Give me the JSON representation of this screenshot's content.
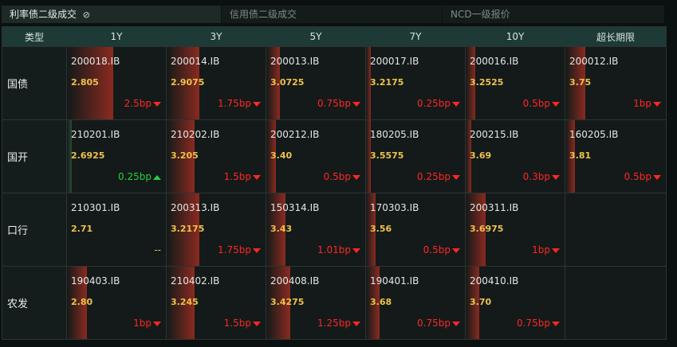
{
  "tabs": [
    {
      "label": "利率债二级成交",
      "active": true
    },
    {
      "label": "信用债二级成交",
      "active": false
    },
    {
      "label": "NCD一级报价",
      "active": false
    }
  ],
  "columns": [
    "类型",
    "1Y",
    "3Y",
    "5Y",
    "7Y",
    "10Y",
    "超长期限"
  ],
  "rows": [
    {
      "label": "国债",
      "cells": [
        {
          "code": "200018.IB",
          "yield": "2.805",
          "change": "2.5bp",
          "dir": "down",
          "bar": 0.47
        },
        {
          "code": "200014.IB",
          "yield": "2.9075",
          "change": "1.75bp",
          "dir": "down",
          "bar": 0.33
        },
        {
          "code": "200013.IB",
          "yield": "3.0725",
          "change": "0.75bp",
          "dir": "down",
          "bar": 0.14
        },
        {
          "code": "200017.IB",
          "yield": "3.2175",
          "change": "0.25bp",
          "dir": "down",
          "bar": 0.05
        },
        {
          "code": "200016.IB",
          "yield": "3.2525",
          "change": "0.5bp",
          "dir": "down",
          "bar": 0.1
        },
        {
          "code": "200012.IB",
          "yield": "3.75",
          "change": "1bp",
          "dir": "down",
          "bar": 0.2
        }
      ]
    },
    {
      "label": "国开",
      "cells": [
        {
          "code": "210201.IB",
          "yield": "2.6925",
          "change": "0.25bp",
          "dir": "up",
          "bar": 0.05
        },
        {
          "code": "210202.IB",
          "yield": "3.205",
          "change": "1.5bp",
          "dir": "down",
          "bar": 0.28
        },
        {
          "code": "200212.IB",
          "yield": "3.40",
          "change": "0.5bp",
          "dir": "down",
          "bar": 0.1
        },
        {
          "code": "180205.IB",
          "yield": "3.5575",
          "change": "0.25bp",
          "dir": "down",
          "bar": 0.05
        },
        {
          "code": "200215.IB",
          "yield": "3.69",
          "change": "0.3bp",
          "dir": "down",
          "bar": 0.06
        },
        {
          "code": "160205.IB",
          "yield": "3.81",
          "change": "0.5bp",
          "dir": "down",
          "bar": 0.1
        }
      ]
    },
    {
      "label": "口行",
      "cells": [
        {
          "code": "210301.IB",
          "yield": "2.71",
          "change": "--",
          "dir": "flat",
          "bar": 0
        },
        {
          "code": "200313.IB",
          "yield": "3.2175",
          "change": "1.75bp",
          "dir": "down",
          "bar": 0.33
        },
        {
          "code": "150314.IB",
          "yield": "3.43",
          "change": "1.01bp",
          "dir": "down",
          "bar": 0.19
        },
        {
          "code": "170303.IB",
          "yield": "3.56",
          "change": "0.5bp",
          "dir": "down",
          "bar": 0.1
        },
        {
          "code": "200311.IB",
          "yield": "3.6975",
          "change": "1bp",
          "dir": "down",
          "bar": 0.2
        },
        null
      ]
    },
    {
      "label": "农发",
      "cells": [
        {
          "code": "190403.IB",
          "yield": "2.80",
          "change": "1bp",
          "dir": "down",
          "bar": 0.2
        },
        {
          "code": "210402.IB",
          "yield": "3.245",
          "change": "1.5bp",
          "dir": "down",
          "bar": 0.28
        },
        {
          "code": "200408.IB",
          "yield": "3.4275",
          "change": "1.25bp",
          "dir": "down",
          "bar": 0.24
        },
        {
          "code": "190401.IB",
          "yield": "3.68",
          "change": "0.75bp",
          "dir": "down",
          "bar": 0.14
        },
        {
          "code": "200410.IB",
          "yield": "3.70",
          "change": "0.75bp",
          "dir": "down",
          "bar": 0.14
        },
        null
      ]
    }
  ],
  "colors": {
    "down": "#ff2626",
    "up": "#25d03a",
    "bar_down": "#8a2a20",
    "bar_up": "#2c4a36"
  }
}
